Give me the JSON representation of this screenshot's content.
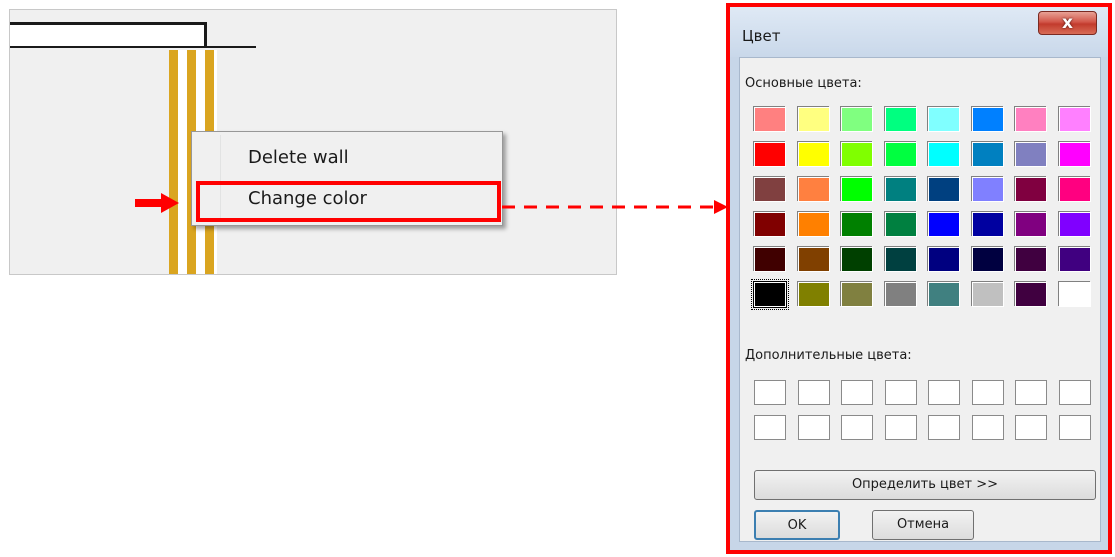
{
  "context_menu": {
    "items": [
      {
        "label": "Delete wall"
      },
      {
        "label": "Change color"
      }
    ]
  },
  "dialog": {
    "title": "Цвет",
    "close_glyph": "x",
    "basic_label": "Основные цвета:",
    "custom_label": "Дополнительные цвета:",
    "define_label": "Определить цвет >>",
    "ok_label": "OK",
    "cancel_label": "Отмена",
    "basic_colors": [
      "#ff8080",
      "#ffff80",
      "#80ff80",
      "#00ff80",
      "#80ffff",
      "#0080ff",
      "#ff80c0",
      "#ff80ff",
      "#ff0000",
      "#ffff00",
      "#80ff00",
      "#00ff40",
      "#00ffff",
      "#0080c0",
      "#8080c0",
      "#ff00ff",
      "#804040",
      "#ff8040",
      "#00ff00",
      "#008080",
      "#004080",
      "#8080ff",
      "#800040",
      "#ff0080",
      "#800000",
      "#ff8000",
      "#008000",
      "#008040",
      "#0000ff",
      "#0000a0",
      "#800080",
      "#8000ff",
      "#400000",
      "#804000",
      "#004000",
      "#004040",
      "#000080",
      "#000040",
      "#400040",
      "#400080",
      "#000000",
      "#808000",
      "#808040",
      "#808080",
      "#408080",
      "#c0c0c0",
      "#400040",
      "#ffffff"
    ],
    "selected_index": 40,
    "custom_colors": [
      "#ffffff",
      "#ffffff",
      "#ffffff",
      "#ffffff",
      "#ffffff",
      "#ffffff",
      "#ffffff",
      "#ffffff",
      "#ffffff",
      "#ffffff",
      "#ffffff",
      "#ffffff",
      "#ffffff",
      "#ffffff",
      "#ffffff",
      "#ffffff"
    ]
  },
  "colors": {
    "highlight": "#ff0000",
    "wall": "#daa520",
    "canvas": "#f0f0f0"
  }
}
